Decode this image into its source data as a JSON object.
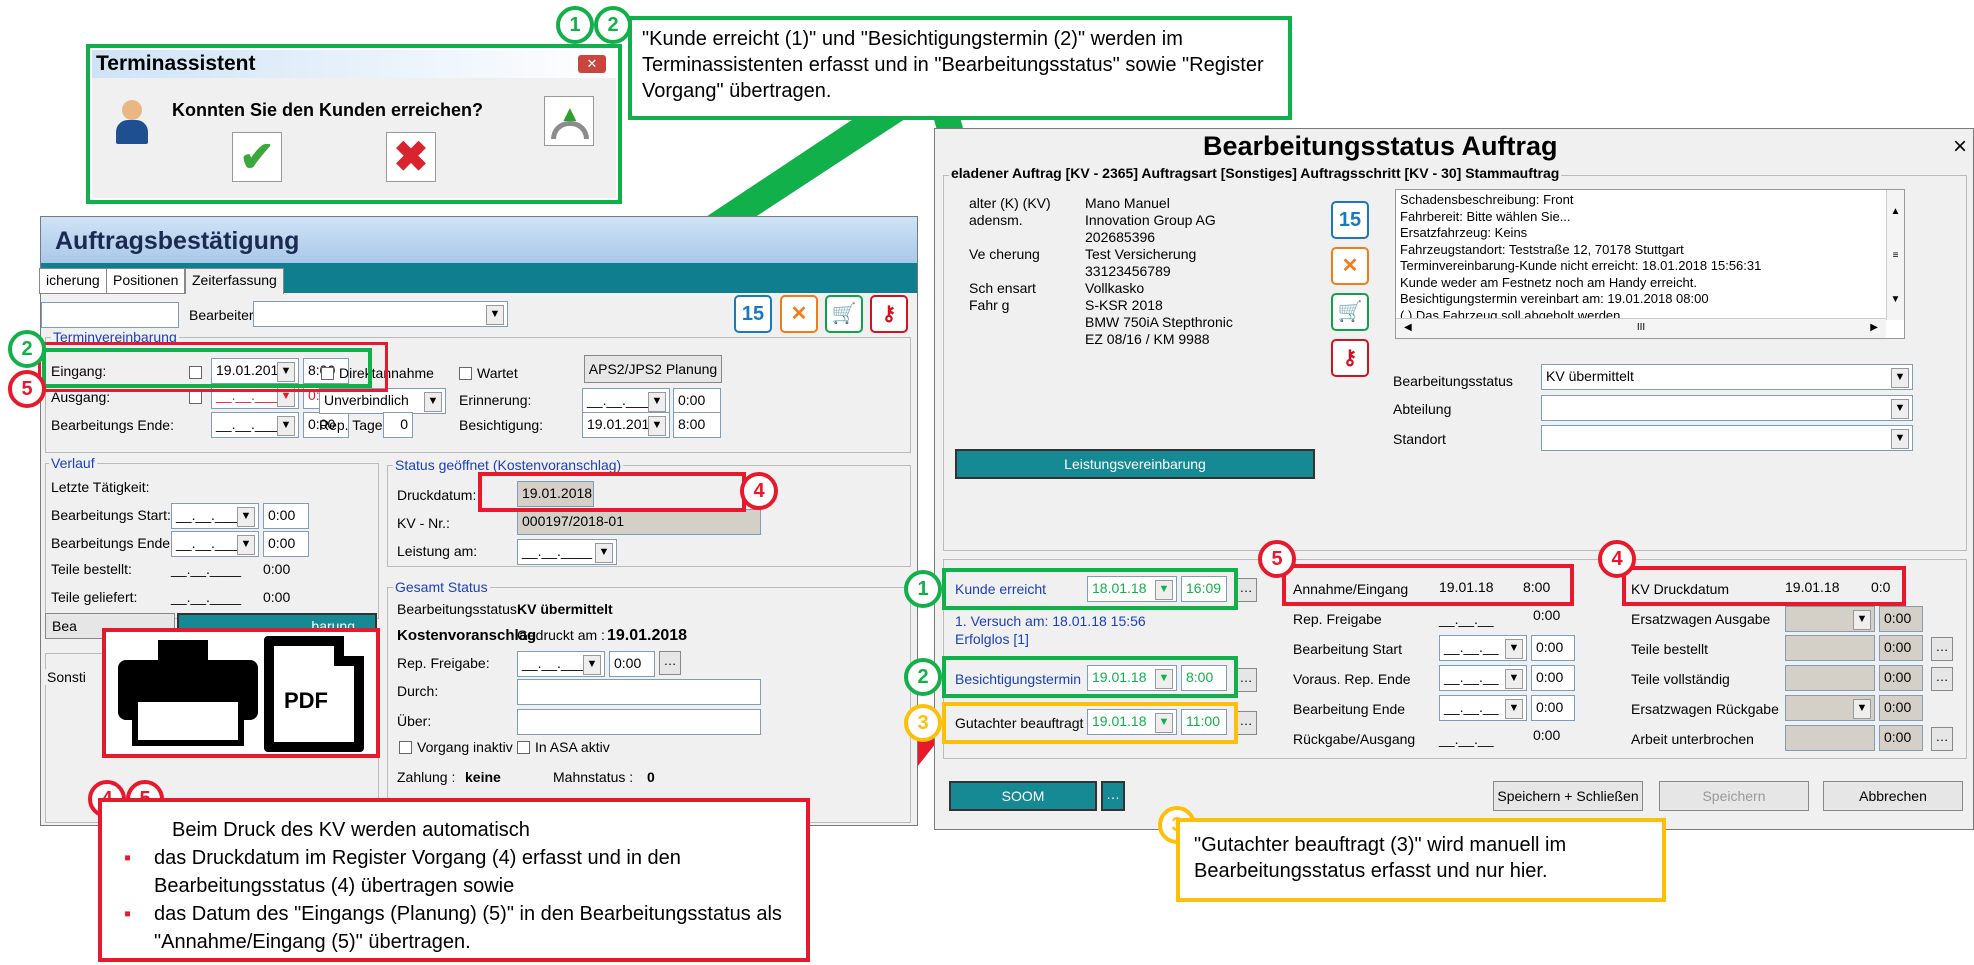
{
  "callout_top": "\"Kunde erreicht (1)\" und \"Besichtigungstermin (2)\" werden im Terminassistenten erfasst und in  \"Bearbeitungsstatus\" sowie \"Register Vorgang\" übertragen.",
  "callout_bottom": {
    "intro": "Beim Druck des KV werden automatisch",
    "bullets": [
      "das Druckdatum im Register Vorgang (4) erfasst und in den Bearbeitungsstatus (4) übertragen sowie",
      "das Datum des \"Eingangs (Planung) (5)\" in den Bearbeitungsstatus als \"Annahme/Eingang (5)\" übertragen."
    ]
  },
  "callout_right": "\"Gutachter beauftragt (3)\" wird manuell im Bearbeitungsstatus erfasst und nur hier.",
  "badges": {
    "one": "1",
    "two": "2",
    "three": "3",
    "four": "4",
    "five": "5"
  },
  "terminassistent": {
    "title": "Terminassistent",
    "question": "Konnten Sie den Kunden erreichen?"
  },
  "pdf_label": "PDF",
  "auftrag": {
    "title": "Auftragsbestätigung",
    "tabs": [
      "icherung",
      "Positionen",
      "Zeiterfassung"
    ],
    "bearbeiter_label": "Bearbeiter:",
    "group_top_title": "Terminvereinbarung",
    "eingang_label": "Eingang:",
    "eingang_date": "19.01.2018",
    "eingang_time": "8:00",
    "ausgang_label": "Ausgang:",
    "ausgang_date": "__.__.____",
    "ausgang_time": "0:00",
    "bearb_ende_label": "Bearbeitungs Ende:",
    "bearb_ende_date": "__.__.____",
    "bearb_ende_time": "0:00",
    "direktannahme": "Direktannahme",
    "wartet": "Wartet",
    "aps_btn": "APS2/JPS2 Planung",
    "unverbindlich": "Unverbindlich",
    "erinnerung_label": "Erinnerung:",
    "erinnerung_date": "__.__.____",
    "erinnerung_time": "0:00",
    "rep_tage_label": "Rep. Tage:",
    "rep_tage": "0",
    "besichtigung_label": "Besichtigung:",
    "besichtigung_date": "19.01.2018",
    "besichtigung_time": "8:00",
    "verlauf_title": "Verlauf",
    "letzte": "Letzte Tätigkeit:",
    "bstart_label": "Bearbeitungs Start:",
    "bstart_date": "__.__.____",
    "bstart_time": "0:00",
    "bende_label": "Bearbeitungs Ende:",
    "bende_date": "__.__.____",
    "bende_time": "0:00",
    "teile_best_label": "Teile bestellt:",
    "teile_best_date": "__.__.____",
    "teile_best_time": "0:00",
    "teile_gel_label": "Teile geliefert:",
    "teile_gel_date": "__.__.____",
    "teile_gel_time": "0:00",
    "bea_btn": "Bea",
    "vereinbarung_btn": "barung",
    "sonst_title": "Sonsti",
    "status_title": "Status geöffnet (Kostenvoranschlag)",
    "druckdatum_label": "Druckdatum:",
    "druckdatum": "19.01.2018",
    "kvnr_label": "KV - Nr.:",
    "kvnr": "000197/2018-01",
    "leistung_label": "Leistung am:",
    "leistung": "__.__.____",
    "gesamt_title": "Gesamt Status",
    "bstatus_label": "Bearbeitungsstatus:",
    "bstatus": "KV übermittelt",
    "kostenvoranschlag": "Kostenvoranschlag",
    "gedruckt_label": "Gedruckt am :",
    "gedruckt": "19.01.2018",
    "repfrei_label": "Rep. Freigabe:",
    "repfrei_date": "__.__.____",
    "repfrei_time": "0:00",
    "durch_label": "Durch:",
    "ueber_label": "Über:",
    "vorgang_inaktiv": "Vorgang inaktiv",
    "in_asa": "In ASA aktiv",
    "zahlung_label": "Zahlung :",
    "zahlung": "keine",
    "mahn_label": "Mahnstatus :",
    "mahn": "0"
  },
  "bstatus_win": {
    "title": "Bearbeitungsstatus Auftrag",
    "close": "×",
    "group_title": "eladener Auftrag [KV - 2365] Auftragsart [Sonstiges] Auftragsschritt [KV - 30] Stammauftrag",
    "info_labels": [
      "alter (K) (KV)",
      "adensm.",
      "Ve  cherung",
      "Sch  ensart",
      "Fahr  g"
    ],
    "info_values": [
      "Mano Manuel",
      "Innovation Group AG",
      "202685396",
      "Test Versicherung",
      "33123456789",
      "Vollkasko",
      "S-KSR 2018",
      "BMW 750iA Stepthronic",
      "EZ 08/16 / KM 9988"
    ],
    "notes": [
      "Schadensbeschreibung: Front",
      "Fahrbereit: Bitte wählen Sie...",
      "Ersatzfahrzeug: Keins",
      "Fahrzeugstandort: Teststraße 12, 70178 Stuttgart",
      "Terminvereinbarung-Kunde nicht erreicht: 18.01.2018 15:56:31",
      "Kunde weder am Festnetz noch am Handy erreicht.",
      "Besichtigungstermin vereinbart am: 19.01.2018 08:00",
      "( ) Das Fahrzeug soll abgeholt werden"
    ],
    "scroll_mid": "III",
    "bstatus_label": "Bearbeitungsstatus",
    "bstatus": "KV übermittelt",
    "abteilung_label": "Abteilung",
    "standort_label": "Standort",
    "leistung_btn": "Leistungsvereinbarung",
    "kunde_label": "Kunde erreicht",
    "kunde_date": "18.01.18",
    "kunde_time": "16:09",
    "versuch": "1. Versuch am: 18.01.18 15:56",
    "erfolglos": "Erfolglos [1]",
    "besich_label": "Besichtigungstermin",
    "besich_date": "19.01.18",
    "besich_time": "8:00",
    "gutachter_label": "Gutachter beauftragt",
    "gutachter_date": "19.01.18",
    "gutachter_time": "11:00",
    "annahme_label": "Annahme/Eingang",
    "annahme_date": "19.01.18",
    "annahme_time": "8:00",
    "repfrei_label": "Rep. Freigabe",
    "repfrei_date": "__.__.__",
    "repfrei_time": "0:00",
    "bstart_label": "Bearbeitung Start",
    "bstart_date": "__.__.__",
    "bstart_time": "0:00",
    "voraus_label": "Voraus. Rep. Ende",
    "voraus_date": "__.__.__",
    "voraus_time": "0:00",
    "bende_label": "Bearbeitung Ende",
    "bende_date": "__.__.__",
    "bende_time": "0:00",
    "rueck_label": "Rückgabe/Ausgang",
    "rueck_date": "__.__.__",
    "rueck_time": "0:00",
    "kvdruck_label": "KV Druckdatum",
    "kvdruck_date": "19.01.18",
    "kvdruck_time": "0:0",
    "ersatz_aus_label": "Ersatzwagen Ausgabe",
    "ersatz_aus_time": "0:00",
    "teile_best_label": "Teile bestellt",
    "teile_best_time": "0:00",
    "teile_voll_label": "Teile vollständig",
    "teile_voll_time": "0:00",
    "ersatz_rueck_label": "Ersatzwagen Rückgabe",
    "ersatz_rueck_time": "0:00",
    "arbeit_label": "Arbeit unterbrochen",
    "arbeit_time": "0:00",
    "soom_btn": "SOOM",
    "speichern_schliessen": "Speichern + Schließen",
    "speichern": "Speichern",
    "abbrechen": "Abbrechen"
  },
  "colors": {
    "green": "#12b04a",
    "red": "#e8192c",
    "yellow": "#fcc00a",
    "teal": "#168a94"
  }
}
